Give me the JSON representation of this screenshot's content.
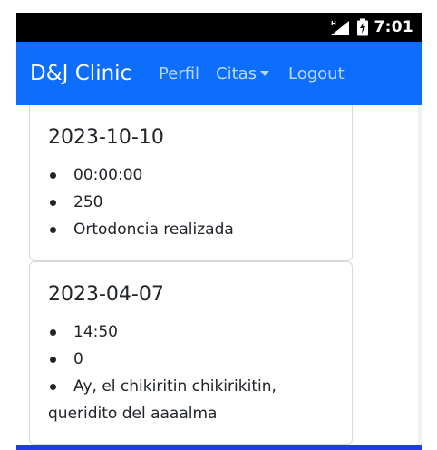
{
  "status_bar": {
    "time": "7:01",
    "icons": [
      "signal-icon",
      "battery-icon"
    ]
  },
  "navbar": {
    "brand": "D&J Clinic",
    "links": {
      "perfil": "Perfil",
      "citas": "Citas",
      "logout": "Logout"
    },
    "colors": {
      "background": "#0d6efd",
      "text": "#ffffff"
    }
  },
  "appointments": [
    {
      "date": "2023-10-10",
      "items": [
        "00:00:00",
        "250",
        "Ortodoncia realizada"
      ]
    },
    {
      "date": "2023-04-07",
      "items": [
        "14:50",
        "0",
        "Ay, el chikiritin chikirikitin, queridito del aaaalma"
      ]
    }
  ]
}
